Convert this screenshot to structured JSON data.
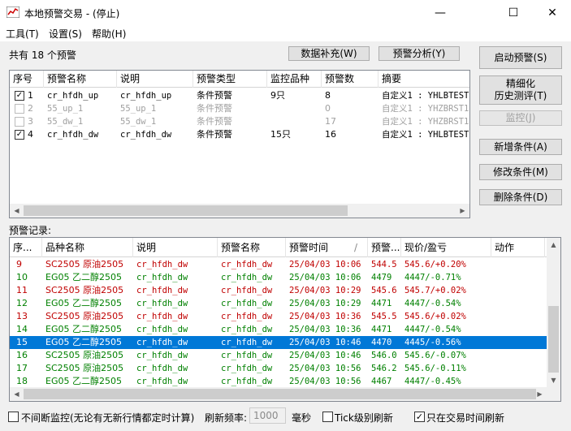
{
  "window": {
    "title": "本地预警交易  - (停止)",
    "min_label": "—",
    "max_label": "☐",
    "close_label": "✕"
  },
  "menu": [
    "工具(T)",
    "设置(S)",
    "帮助(H)"
  ],
  "summary": {
    "count_text": "共有 18 个预警"
  },
  "toolbar": {
    "data_fill": "数据补充(W)",
    "analysis": "预警分析(Y)"
  },
  "right_buttons": {
    "start": "启动预警(S)",
    "backtest_line1": "精细化",
    "backtest_line2": "历史测评(T)",
    "monitor": "监控(J)",
    "add": "新增条件(A)",
    "modify": "修改条件(M)",
    "delete": "删除条件(D)"
  },
  "alerts_table": {
    "columns": [
      "序号",
      "预警名称",
      "说明",
      "预警类型",
      "监控品种",
      "预警数",
      "摘要"
    ],
    "rows": [
      {
        "checked": true,
        "enabled": true,
        "no": "1",
        "name": "cr_hfdh_up",
        "desc": "cr_hfdh_up",
        "type": "条件预警",
        "symbols": "9只",
        "count": "8",
        "summary": "自定义1 : YHLBTEST"
      },
      {
        "checked": false,
        "enabled": false,
        "no": "2",
        "name": "55_up_1",
        "desc": "55_up_1",
        "type": "条件预警",
        "symbols": "",
        "count": "0",
        "summary": "自定义1 : YHZBRST1"
      },
      {
        "checked": false,
        "enabled": false,
        "no": "3",
        "name": "55_dw_1",
        "desc": "55_dw_1",
        "type": "条件预警",
        "symbols": "",
        "count": "17",
        "summary": "自定义1 : YHZBRST1"
      },
      {
        "checked": true,
        "enabled": true,
        "no": "4",
        "name": "cr_hfdh_dw",
        "desc": "cr_hfdh_dw",
        "type": "条件预警",
        "symbols": "15只",
        "count": "16",
        "summary": "自定义1 : YHLBTEST"
      }
    ]
  },
  "records_label": "预警记录:",
  "records_table": {
    "columns": [
      "序...",
      "品种名称",
      "说明",
      "预警名称",
      "预警时间",
      "预警...",
      "现价/盈亏",
      "动作"
    ],
    "sort_mark": "/",
    "rows": [
      {
        "no": "9",
        "symbol": "SC2505 原油2505",
        "desc": "cr_hfdh_dw",
        "name": "cr_hfdh_dw",
        "time": "25/04/03 10:06",
        "price": "544.5",
        "pnl": "545.6/+0.20%",
        "color": "red"
      },
      {
        "no": "10",
        "symbol": "EG05 乙二醇2505",
        "desc": "cr_hfdh_dw",
        "name": "cr_hfdh_dw",
        "time": "25/04/03 10:06",
        "price": "4479",
        "pnl": "4447/-0.71%",
        "color": "green"
      },
      {
        "no": "11",
        "symbol": "SC2505 原油2505",
        "desc": "cr_hfdh_dw",
        "name": "cr_hfdh_dw",
        "time": "25/04/03 10:29",
        "price": "545.6",
        "pnl": "545.7/+0.02%",
        "color": "red"
      },
      {
        "no": "12",
        "symbol": "EG05 乙二醇2505",
        "desc": "cr_hfdh_dw",
        "name": "cr_hfdh_dw",
        "time": "25/04/03 10:29",
        "price": "4471",
        "pnl": "4447/-0.54%",
        "color": "green"
      },
      {
        "no": "13",
        "symbol": "SC2505 原油2505",
        "desc": "cr_hfdh_dw",
        "name": "cr_hfdh_dw",
        "time": "25/04/03 10:36",
        "price": "545.5",
        "pnl": "545.6/+0.02%",
        "color": "red"
      },
      {
        "no": "14",
        "symbol": "EG05 乙二醇2505",
        "desc": "cr_hfdh_dw",
        "name": "cr_hfdh_dw",
        "time": "25/04/03 10:36",
        "price": "4471",
        "pnl": "4447/-0.54%",
        "color": "green"
      },
      {
        "no": "15",
        "symbol": "EG05 乙二醇2505",
        "desc": "cr_hfdh_dw",
        "name": "cr_hfdh_dw",
        "time": "25/04/03 10:46",
        "price": "4470",
        "pnl": "4445/-0.56%",
        "color": "selected"
      },
      {
        "no": "16",
        "symbol": "SC2505 原油2505",
        "desc": "cr_hfdh_dw",
        "name": "cr_hfdh_dw",
        "time": "25/04/03 10:46",
        "price": "546.0",
        "pnl": "545.6/-0.07%",
        "color": "green"
      },
      {
        "no": "17",
        "symbol": "SC2505 原油2505",
        "desc": "cr_hfdh_dw",
        "name": "cr_hfdh_dw",
        "time": "25/04/03 10:56",
        "price": "546.2",
        "pnl": "545.6/-0.11%",
        "color": "green"
      },
      {
        "no": "18",
        "symbol": "EG05 乙二醇2505",
        "desc": "cr_hfdh_dw",
        "name": "cr_hfdh_dw",
        "time": "25/04/03 10:56",
        "price": "4467",
        "pnl": "4447/-0.45%",
        "color": "green"
      }
    ]
  },
  "footer": {
    "continuous_label": "不间断监控(无论有无新行情都定时计算)",
    "continuous_checked": false,
    "refresh_label": "刷新频率:",
    "refresh_value": "1000",
    "ms_label": "毫秒",
    "tick_label": "Tick级别刷新",
    "tick_checked": false,
    "trade_time_label": "只在交易时间刷新",
    "trade_time_checked": true
  },
  "colors": {
    "red": "#c00000",
    "green": "#008000",
    "selected": "#0078d7"
  }
}
